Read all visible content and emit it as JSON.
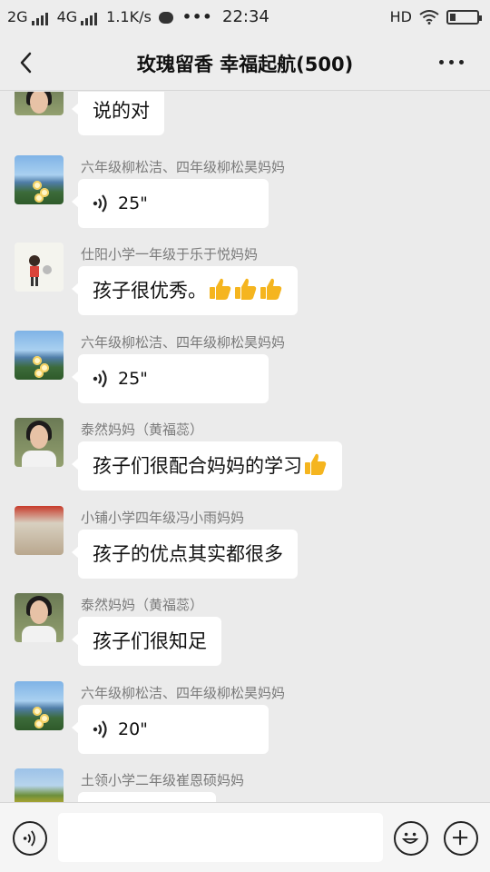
{
  "status_bar": {
    "net1": "2G",
    "net2": "4G",
    "speed": "1.1K/s",
    "time": "22:34",
    "hd": "HD",
    "battery_level": 0.2
  },
  "header": {
    "title": "玫瑰留香 幸福起航(500)"
  },
  "messages": [
    {
      "sender": "",
      "text": "说的对",
      "type": "text",
      "avatar": "woman-portrait"
    },
    {
      "sender": "六年级柳松洁、四年级柳松昊妈妈",
      "text": "25\"",
      "type": "voice",
      "avatar": "lake-flowers"
    },
    {
      "sender": "仕阳小学一年级于乐于悦妈妈",
      "text": "孩子很优秀。",
      "type": "text",
      "thumbs": 3,
      "avatar": "child-cartoon"
    },
    {
      "sender": "六年级柳松洁、四年级柳松昊妈妈",
      "text": "25\"",
      "type": "voice",
      "avatar": "lake-flowers"
    },
    {
      "sender": "泰然妈妈（黄福蕊）",
      "text": "孩子们很配合妈妈的学习",
      "type": "text",
      "thumbs": 1,
      "avatar": "woman-portrait"
    },
    {
      "sender": "小铺小学四年级冯小雨妈妈",
      "text": "孩子的优点其实都很多",
      "type": "text",
      "avatar": "shop-photo"
    },
    {
      "sender": "泰然妈妈（黄福蕊）",
      "text": "孩子们很知足",
      "type": "text",
      "avatar": "woman-portrait"
    },
    {
      "sender": "六年级柳松洁、四年级柳松昊妈妈",
      "text": "20\"",
      "type": "voice",
      "avatar": "lake-flowers"
    },
    {
      "sender": "土领小学二年级崔恩硕妈妈",
      "text": "",
      "type": "text",
      "avatar": "field-flowers"
    }
  ],
  "input": {
    "value": "",
    "placeholder": ""
  },
  "colors": {
    "background": "#ebebeb",
    "bubble": "#ffffff",
    "sender_text": "#7a7a7a",
    "thumb": "#f5b51f"
  }
}
